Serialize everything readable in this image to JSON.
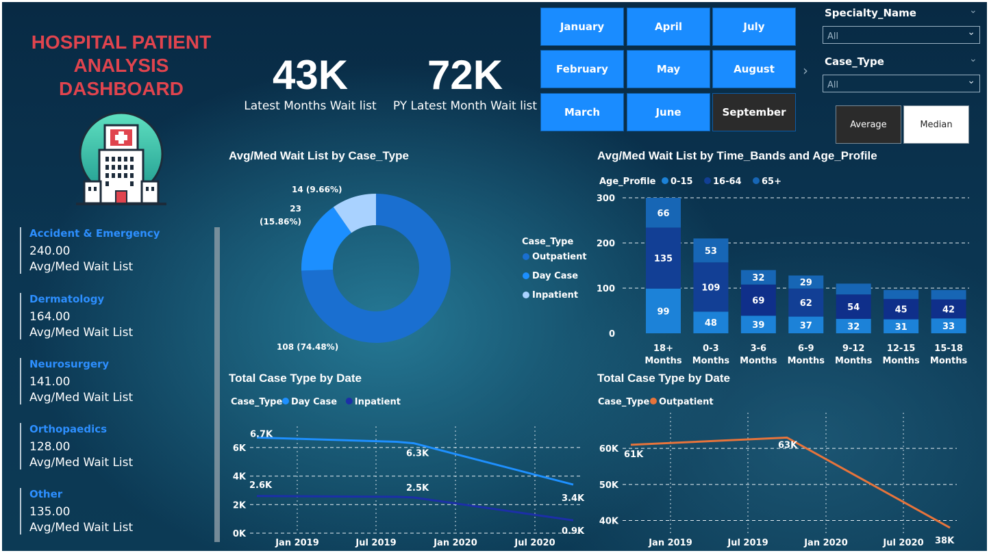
{
  "title": "HOSPITAL PATIENT ANALYSIS DASHBOARD",
  "kpis": [
    {
      "value": "43K",
      "label": "Latest Months Wait list"
    },
    {
      "value": "72K",
      "label": "PY Latest Month Wait list"
    }
  ],
  "months": [
    "January",
    "April",
    "July",
    "February",
    "May",
    "August",
    "March",
    "June",
    "September"
  ],
  "selected_month": "September",
  "slicers": {
    "specialty": {
      "title": "Specialty_Name",
      "value": "All"
    },
    "case_type": {
      "title": "Case_Type",
      "value": "All"
    }
  },
  "aggregation": {
    "average": "Average",
    "median": "Median",
    "selected": "Median"
  },
  "specialties": [
    {
      "name": "Accident & Emergency",
      "value": "240.00",
      "label": "Avg/Med Wait List"
    },
    {
      "name": "Dermatology",
      "value": "164.00",
      "label": "Avg/Med Wait List"
    },
    {
      "name": "Neurosurgery",
      "value": "141.00",
      "label": "Avg/Med Wait List"
    },
    {
      "name": "Orthopaedics",
      "value": "128.00",
      "label": "Avg/Med Wait List"
    },
    {
      "name": "Other",
      "value": "135.00",
      "label": "Avg/Med Wait List"
    }
  ],
  "colors": {
    "title_red": "#e0444e",
    "outpatient": "#1a6fd0",
    "day_case": "#1c8fff",
    "inpatient": "#a9d2ff",
    "age_0_15": "#1c82d8",
    "age_16_64": "#123f95",
    "age_65_plus": "#1766b5",
    "line_orange": "#e8743b",
    "line_daycase": "#1e90ff",
    "line_inpatient": "#1c2fa8"
  },
  "chart_data": [
    {
      "type": "pie",
      "title": "Avg/Med Wait List by Case_Type",
      "legend_title": "Case_Type",
      "legend_position": "right",
      "slices": [
        {
          "name": "Outpatient",
          "value": 108,
          "label": "108 (74.48%)"
        },
        {
          "name": "Day Case",
          "value": 23,
          "label": "23 (15.86%)"
        },
        {
          "name": "Inpatient",
          "value": 14,
          "label": "14 (9.66%)"
        }
      ]
    },
    {
      "type": "bar",
      "stacked": true,
      "title": "Avg/Med Wait List by Time_Bands and Age_Profile",
      "legend_title": "Age_Profile",
      "legend_position": "top-left",
      "categories": [
        "18+ Months",
        "0-3 Months",
        "3-6 Months",
        "6-9 Months",
        "9-12 Months",
        "12-15 Months",
        "15-18 Months"
      ],
      "series": [
        {
          "name": "0-15",
          "values": [
            99,
            48,
            39,
            37,
            32,
            31,
            33
          ]
        },
        {
          "name": "16-64",
          "values": [
            135,
            109,
            69,
            62,
            54,
            45,
            42
          ]
        },
        {
          "name": "65+",
          "values": [
            66,
            53,
            32,
            29,
            24,
            20,
            21
          ]
        }
      ],
      "series_labels_shown": {
        "0-15": [
          "99",
          "48",
          "39",
          "37",
          "32",
          "31",
          "33"
        ],
        "16-64": [
          "135",
          "109",
          "69",
          "62",
          "54",
          "45",
          "42"
        ],
        "65+": [
          "66",
          "53",
          "32",
          "29",
          "",
          "",
          ""
        ]
      },
      "yticks": [
        "0",
        "100",
        "200",
        "300"
      ],
      "ylim": [
        0,
        300
      ],
      "grid": true
    },
    {
      "type": "line",
      "title": "Total Case Type by Date",
      "legend_title": "Case_Type",
      "legend_position": "top-left",
      "x": [
        "2018-09",
        "2019-09",
        "2019-10",
        "2020-09"
      ],
      "xticks": [
        "Jan 2019",
        "Jul 2019",
        "Jan 2020",
        "Jul 2020"
      ],
      "series": [
        {
          "name": "Day Case",
          "values": [
            6700,
            6400,
            6300,
            3400
          ],
          "labels": [
            "6.7K",
            "",
            "6.3K",
            "3.4K"
          ]
        },
        {
          "name": "Inpatient",
          "values": [
            2600,
            2550,
            2500,
            900
          ],
          "labels": [
            "2.6K",
            "",
            "2.5K",
            "0.9K"
          ]
        }
      ],
      "yticks": [
        "0K",
        "2K",
        "4K",
        "6K"
      ],
      "ylim": [
        0,
        7000
      ],
      "grid": true
    },
    {
      "type": "line",
      "title": "Total Case Type by Date",
      "legend_title": "Case_Type",
      "legend_position": "top-left",
      "x": [
        "2018-09",
        "2019-09",
        "2020-09"
      ],
      "xticks": [
        "Jan 2019",
        "Jul 2019",
        "Jan 2020",
        "Jul 2020"
      ],
      "series": [
        {
          "name": "Outpatient",
          "values": [
            61000,
            63000,
            38000
          ],
          "labels": [
            "61K",
            "63K",
            "38K"
          ]
        }
      ],
      "yticks": [
        "40K",
        "50K",
        "60K"
      ],
      "ylim": [
        36500,
        68000
      ],
      "grid": true
    }
  ]
}
